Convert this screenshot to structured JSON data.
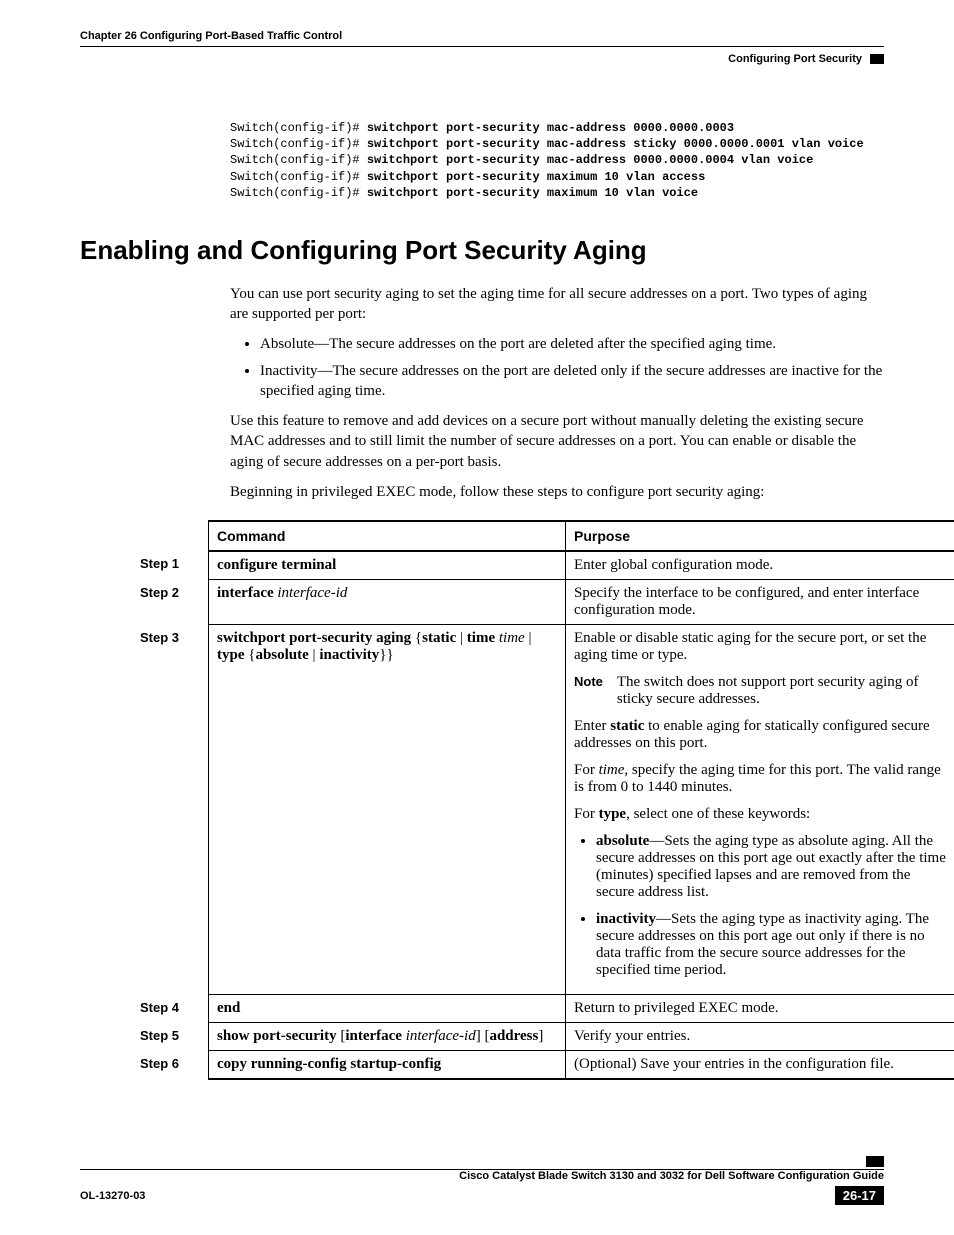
{
  "header": {
    "chapter": "Chapter 26    Configuring Port-Based Traffic Control",
    "section": "Configuring Port Security"
  },
  "code": {
    "p1": "Switch(config-if)# ",
    "c1": "switchport port-security mac-address 0000.0000.0003",
    "p2": "Switch(config-if)# ",
    "c2": "switchport port-security mac-address sticky 0000.0000.0001 vlan voice",
    "p3": "Switch(config-if)# ",
    "c3": "switchport port-security mac-address 0000.0000.0004 vlan voice",
    "p4": "Switch(config-if)# ",
    "c4": "switchport port-security maximum 10 vlan access",
    "p5": "Switch(config-if)# ",
    "c5": "switchport port-security maximum 10 vlan voice"
  },
  "heading": "Enabling and Configuring Port Security Aging",
  "intro": {
    "p1": "You can use port security aging to set the aging time for all secure addresses on a port. Two types of aging are supported per port:",
    "b1": "Absolute—The secure addresses on the port are deleted after the specified aging time.",
    "b2": "Inactivity—The secure addresses on the port are deleted only if the secure addresses are inactive for the specified aging time.",
    "p2": "Use this feature to remove and add devices on a secure port without manually deleting the existing secure MAC addresses and to still limit the number of secure addresses on a port. You can enable or disable the aging of secure addresses on a per-port basis.",
    "p3": "Beginning in privileged EXEC mode, follow these steps to configure port security aging:"
  },
  "table": {
    "h_command": "Command",
    "h_purpose": "Purpose",
    "s1": "Step 1",
    "s2": "Step 2",
    "s3": "Step 3",
    "s4": "Step 4",
    "s5": "Step 5",
    "s6": "Step 6",
    "r1_cmd": "configure terminal",
    "r1_purpose": "Enter global configuration mode.",
    "r2_cmd_b1": "interface",
    "r2_cmd_i1": " interface-id",
    "r2_purpose": "Specify the interface to be configured, and enter interface configuration mode.",
    "r3_cmd_b1": "switchport port-security aging",
    "r3_cmd_t1": " {",
    "r3_cmd_b2": "static",
    "r3_cmd_t2": " | ",
    "r3_cmd_b3": "time",
    "r3_cmd_i1": " time",
    "r3_cmd_t3": " | ",
    "r3_cmd_b4": "type",
    "r3_cmd_t4": " {",
    "r3_cmd_b5": "absolute",
    "r3_cmd_t5": " | ",
    "r3_cmd_b6": "inactivity",
    "r3_cmd_t6": "}}",
    "r3_p1": "Enable or disable static aging for the secure port, or set the aging time or type.",
    "r3_note_label": "Note",
    "r3_note": "The switch does not support port security aging of sticky secure addresses.",
    "r3_p2a": "Enter ",
    "r3_p2b": "static",
    "r3_p2c": " to enable aging for statically configured secure addresses on this port.",
    "r3_p3a": "For ",
    "r3_p3b": "time",
    "r3_p3c": ", specify the aging time for this port. The valid range is from 0 to 1440 minutes.",
    "r3_p4a": "For ",
    "r3_p4b": "type",
    "r3_p4c": ", select one of these keywords:",
    "r3_li1b": "absolute",
    "r3_li1t": "—Sets the aging type as absolute aging. All the secure addresses on this port age out exactly after the time (minutes) specified lapses and are removed from the secure address list.",
    "r3_li2b": "inactivity",
    "r3_li2t": "—Sets the aging type as inactivity aging. The secure addresses on this port age out only if there is no data traffic from the secure source addresses for the specified time period.",
    "r4_cmd": "end",
    "r4_purpose": "Return to privileged EXEC mode.",
    "r5_cmd_b1": "show port-security",
    "r5_cmd_t1": " [",
    "r5_cmd_b2": "interface",
    "r5_cmd_i1": " interface-id",
    "r5_cmd_t2": "] [",
    "r5_cmd_b3": "address",
    "r5_cmd_t3": "]",
    "r5_purpose": "Verify your entries.",
    "r6_cmd": "copy running-config startup-config",
    "r6_purpose": "(Optional) Save your entries in the configuration file."
  },
  "footer": {
    "guide": "Cisco Catalyst Blade Switch 3130 and 3032 for Dell Software Configuration Guide",
    "doc_id": "OL-13270-03",
    "page_num": "26-17"
  }
}
